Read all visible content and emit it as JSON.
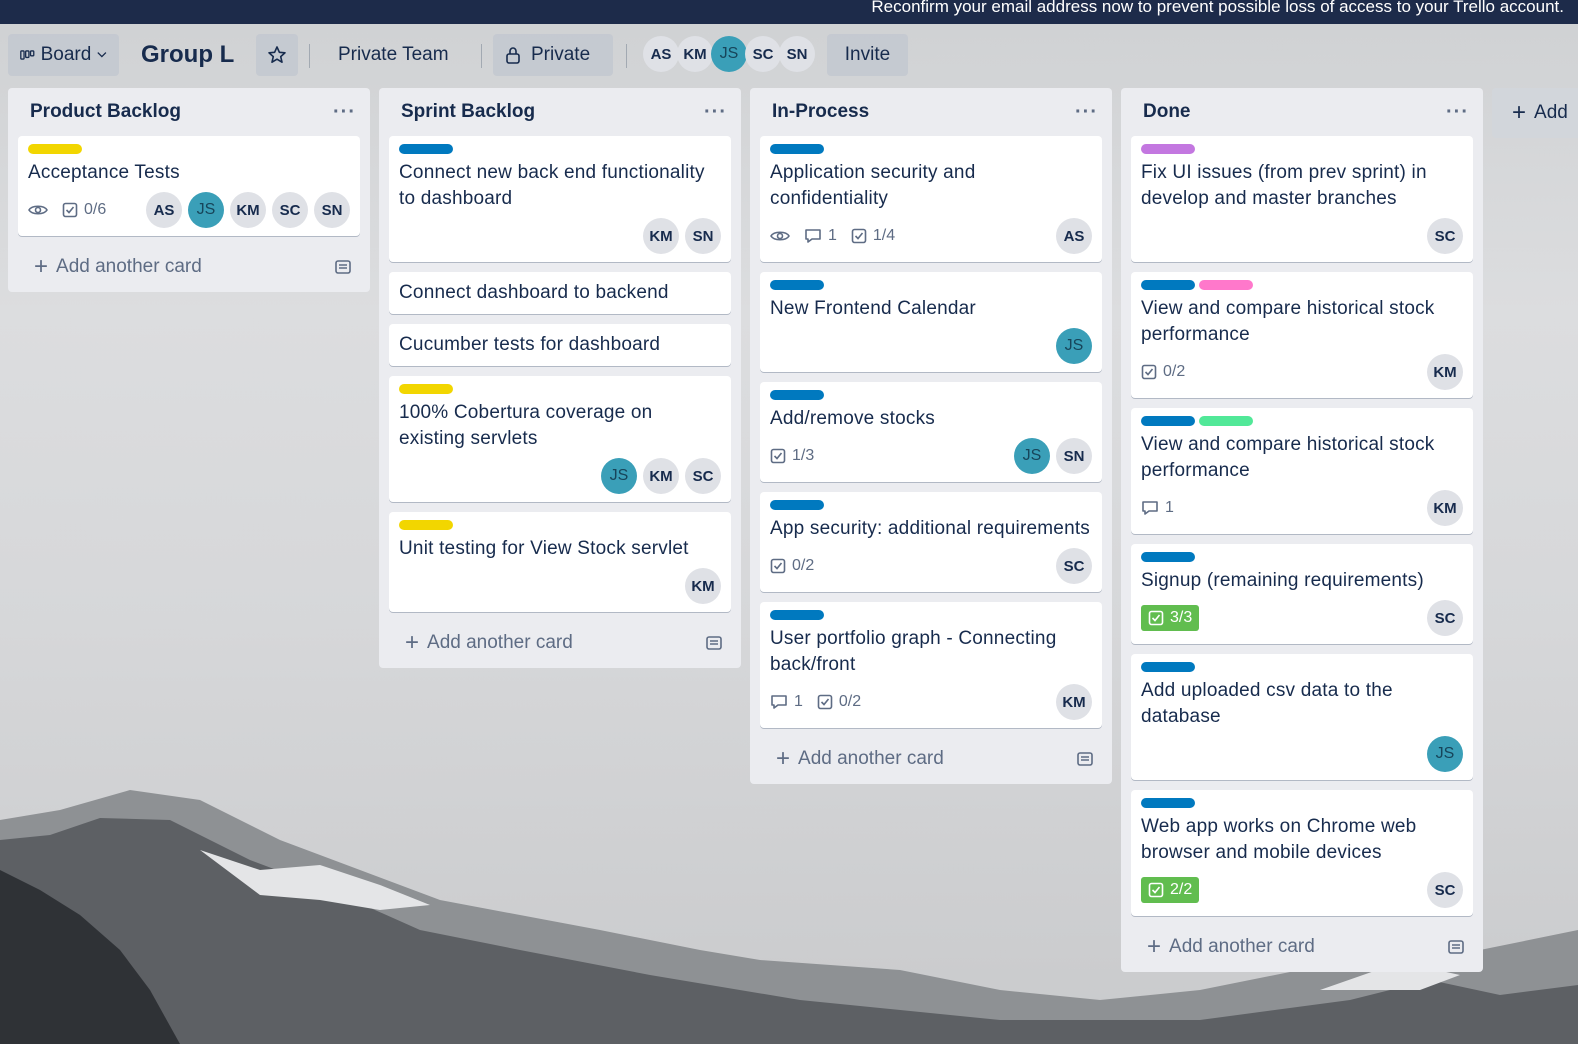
{
  "banner": {
    "text": "Reconfirm your email address now to prevent possible loss of access to your Trello account."
  },
  "topbar": {
    "view_label": "Board",
    "board_name": "Group L",
    "team_label": "Private Team",
    "visibility_label": "Private",
    "invite_label": "Invite",
    "members": [
      "AS",
      "KM",
      "JS",
      "SC",
      "SN"
    ]
  },
  "lists": [
    {
      "title": "Product Backlog",
      "add_label": "Add another card",
      "cards": [
        {
          "labels": [
            "#f2d600"
          ],
          "title": "Acceptance Tests",
          "watch": true,
          "checklist": "0/6",
          "members": [
            "AS",
            "JS",
            "KM",
            "SC",
            "SN"
          ]
        }
      ]
    },
    {
      "title": "Sprint Backlog",
      "add_label": "Add another card",
      "cards": [
        {
          "labels": [
            "#0079bf"
          ],
          "title": "Connect new back end functionality to dashboard",
          "members": [
            "KM",
            "SN"
          ]
        },
        {
          "labels": [],
          "title": "Connect dashboard to backend",
          "members": []
        },
        {
          "labels": [],
          "title": "Cucumber tests for dashboard",
          "members": []
        },
        {
          "labels": [
            "#f2d600"
          ],
          "title": "100% Cobertura coverage on existing servlets",
          "members": [
            "JS",
            "KM",
            "SC"
          ]
        },
        {
          "labels": [
            "#f2d600"
          ],
          "title": "Unit testing for View Stock servlet",
          "members": [
            "KM"
          ]
        }
      ]
    },
    {
      "title": "In-Process",
      "add_label": "Add another card",
      "cards": [
        {
          "labels": [
            "#0079bf"
          ],
          "title": "Application security and confidentiality",
          "watch": true,
          "comments": "1",
          "checklist": "1/4",
          "members": [
            "AS"
          ]
        },
        {
          "labels": [
            "#0079bf"
          ],
          "title": "New Frontend Calendar",
          "members": [
            "JS"
          ]
        },
        {
          "labels": [
            "#0079bf"
          ],
          "title": "Add/remove stocks",
          "checklist": "1/3",
          "members": [
            "JS",
            "SN"
          ]
        },
        {
          "labels": [
            "#0079bf"
          ],
          "title": "App security: additional requirements",
          "checklist": "0/2",
          "members": [
            "SC"
          ]
        },
        {
          "labels": [
            "#0079bf"
          ],
          "title": "User portfolio graph - Connecting back/front",
          "comments": "1",
          "checklist": "0/2",
          "members": [
            "KM"
          ]
        }
      ]
    },
    {
      "title": "Done",
      "add_label": "Add another card",
      "cards": [
        {
          "labels": [
            "#c377e0"
          ],
          "title": "Fix UI issues (from prev sprint) in develop and master branches",
          "members": [
            "SC"
          ]
        },
        {
          "labels": [
            "#0079bf",
            "#ff78cb"
          ],
          "title": "View and compare historical stock performance",
          "checklist": "0/2",
          "members": [
            "KM"
          ]
        },
        {
          "labels": [
            "#0079bf",
            "#51e898"
          ],
          "title": "View and compare historical stock performance",
          "comments": "1",
          "members": [
            "KM"
          ]
        },
        {
          "labels": [
            "#0079bf"
          ],
          "title": "Signup (remaining requirements)",
          "checklist_done": "3/3",
          "members": [
            "SC"
          ]
        },
        {
          "labels": [
            "#0079bf"
          ],
          "title": "Add uploaded csv data to the database",
          "members": [
            "JS"
          ]
        },
        {
          "labels": [
            "#0079bf"
          ],
          "title": "Web app works on Chrome web browser and mobile devices",
          "checklist_done": "2/2",
          "members": [
            "SC"
          ]
        }
      ]
    }
  ],
  "add_list_label": "Add"
}
